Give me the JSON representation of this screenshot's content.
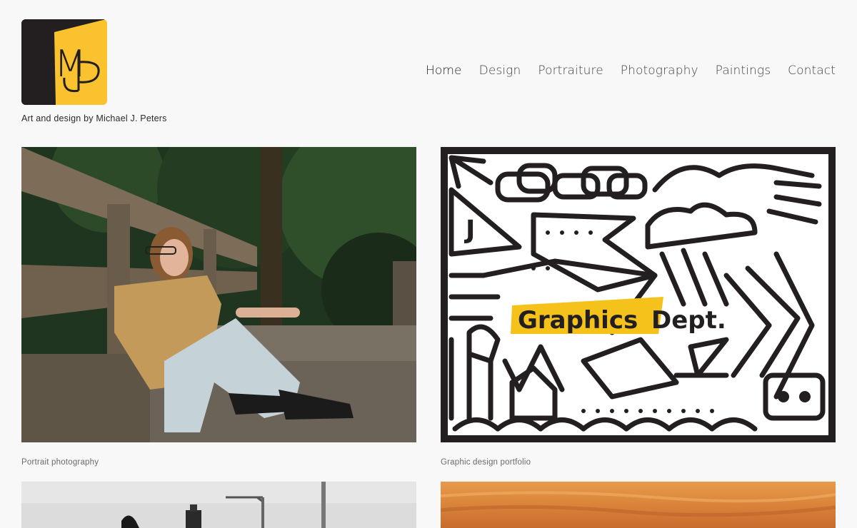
{
  "site": {
    "logo_text": "MJP",
    "tagline": "Art and design by Michael J. Peters"
  },
  "nav": {
    "items": [
      {
        "label": "Home",
        "active": true
      },
      {
        "label": "Design"
      },
      {
        "label": "Portraiture"
      },
      {
        "label": "Photography"
      },
      {
        "label": "Paintings"
      },
      {
        "label": "Contact"
      }
    ]
  },
  "gallery": {
    "items": [
      {
        "caption": "Portrait photography"
      },
      {
        "caption": "Graphic design portfolio",
        "art_text_1": "Graphics",
        "art_text_2": "Dept.",
        "art_letter": "J"
      },
      {
        "caption": ""
      },
      {
        "caption": ""
      }
    ]
  },
  "colors": {
    "logo_yellow": "#f9c22e",
    "logo_dark": "#231f20",
    "accent_yellow": "#f5c21b"
  }
}
